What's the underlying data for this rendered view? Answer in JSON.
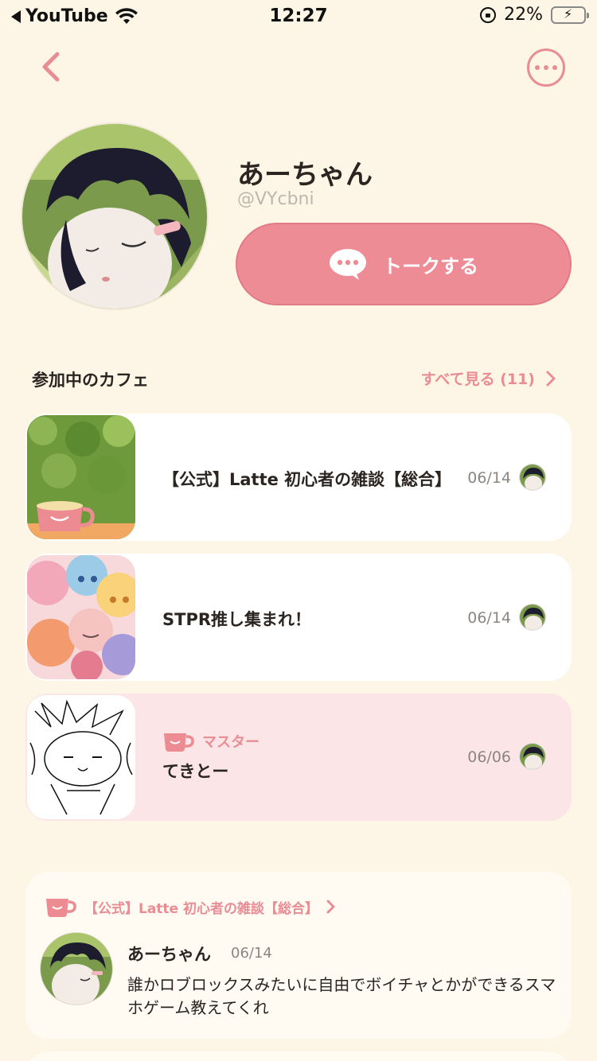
{
  "status_bar": {
    "back_app": "YouTube",
    "time": "12:27",
    "battery": "22%",
    "battery_level": 0.22
  },
  "header": {
    "back_icon": "chevron-left-icon",
    "more_icon": "more-horizontal-icon"
  },
  "profile": {
    "name": "あーちゃん",
    "handle": "@VYcbni",
    "talk_button": "トークする"
  },
  "cafes_section": {
    "title": "参加中のカフェ",
    "see_all": "すべて見る (11)",
    "items": [
      {
        "name": "【公式】Latte 初心者の雑談【総合】",
        "date": "06/14",
        "role": ""
      },
      {
        "name": "STPR推し集まれ！",
        "date": "06/14",
        "role": ""
      },
      {
        "name": "てきとー",
        "date": "06/06",
        "role": "マスター"
      }
    ]
  },
  "post": {
    "cafe": "【公式】Latte 初心者の雑談【総合】",
    "author": "あーちゃん",
    "date": "06/14",
    "body": "誰かロブロックスみたいに自由でボイチャとかができるスマホゲーム教えてくれ"
  },
  "colors": {
    "background": "#fdf6e6",
    "accent": "#ee8c95",
    "master_card": "#fbe5e6"
  }
}
